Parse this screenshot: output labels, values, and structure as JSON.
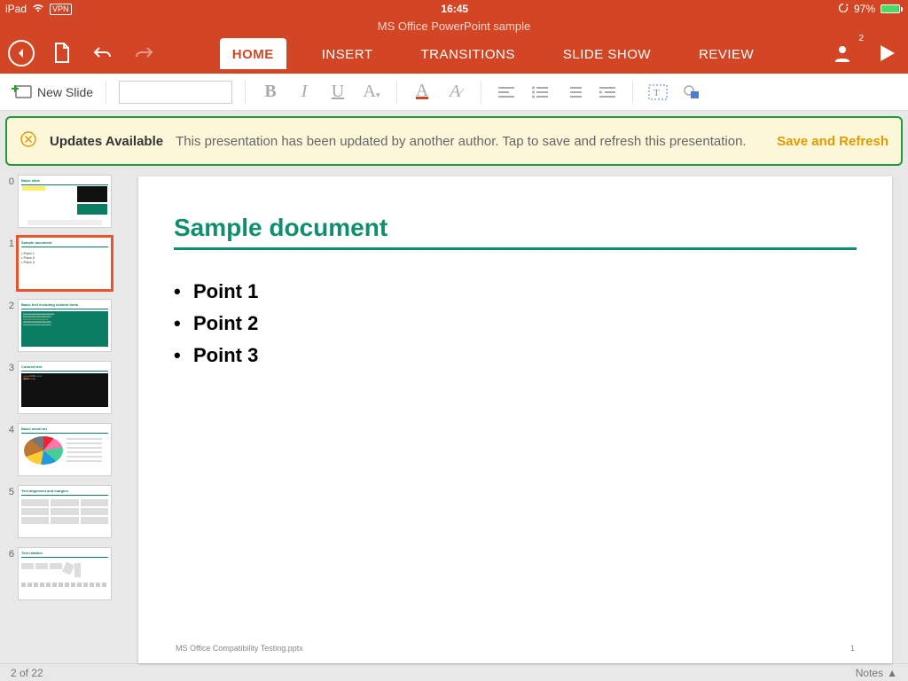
{
  "statusbar": {
    "device": "iPad",
    "vpn": "VPN",
    "time": "16:45",
    "battery_pct": "97%"
  },
  "app": {
    "title": "MS Office PowerPoint sample",
    "user_count": "2"
  },
  "tabs": {
    "home": "HOME",
    "insert": "INSERT",
    "transitions": "TRANSITIONS",
    "slideshow": "SLIDE SHOW",
    "review": "REVIEW"
  },
  "ribbon": {
    "new_slide": "New Slide",
    "font_name": ""
  },
  "banner": {
    "title": "Updates Available",
    "message": "This presentation has been updated by another author. Tap to save and refresh this presentation.",
    "action": "Save and Refresh"
  },
  "slide": {
    "title": "Sample document",
    "points": {
      "p1": "Point 1",
      "p2": "Point 2",
      "p3": "Point 3"
    },
    "footer_left": "MS Office Compatibility Testing.pptx",
    "footer_right": "1"
  },
  "thumbs": {
    "n0": "0",
    "n1": "1",
    "n2": "2",
    "n3": "3",
    "n4": "4",
    "n5": "5",
    "n6": "6",
    "t1_title": "Sample document",
    "t1_p1": "Point 1",
    "t1_p2": "Point 2",
    "t1_p3": "Point 3"
  },
  "footer": {
    "counter": "2 of 22",
    "notes": "Notes"
  }
}
